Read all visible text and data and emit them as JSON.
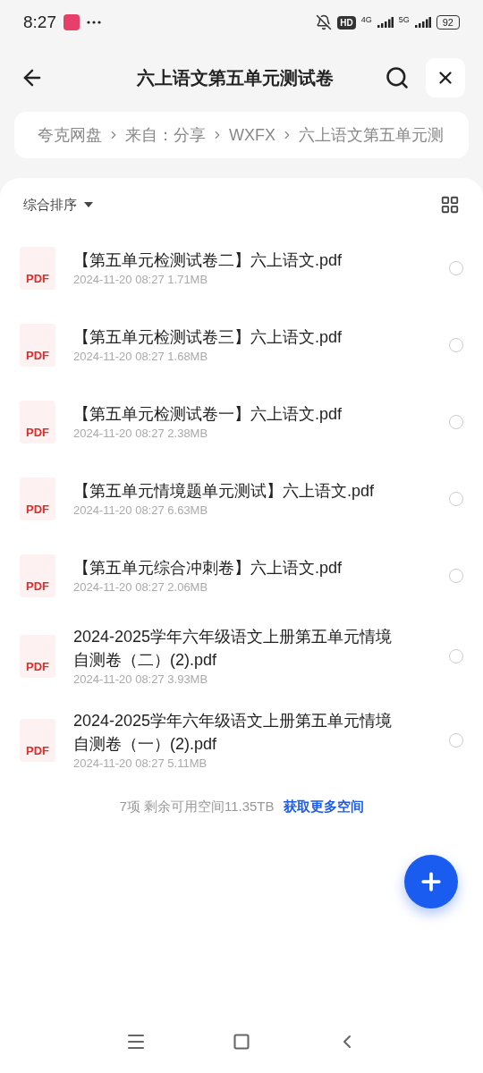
{
  "status_bar": {
    "time": "8:27",
    "hd": "HD",
    "net1": "4G",
    "net2": "5G",
    "battery": "92"
  },
  "header": {
    "title": "六上语文第五单元测试卷"
  },
  "breadcrumb": [
    "夸克网盘",
    "来自：分享",
    "WXFX",
    "六上语文第五单元测"
  ],
  "sort": {
    "label": "综合排序"
  },
  "files": [
    {
      "badge": "PDF",
      "name": "【第五单元检测试卷二】六上语文.pdf",
      "date": "2024-11-20 08:27",
      "size": "1.71MB",
      "selected": false
    },
    {
      "badge": "PDF",
      "name": "【第五单元检测试卷三】六上语文.pdf",
      "date": "2024-11-20 08:27",
      "size": "1.68MB",
      "selected": false
    },
    {
      "badge": "PDF",
      "name": "【第五单元检测试卷一】六上语文.pdf",
      "date": "2024-11-20 08:27",
      "size": "2.38MB",
      "selected": false
    },
    {
      "badge": "PDF",
      "name": "【第五单元情境题单元测试】六上语文.pdf",
      "date": "2024-11-20 08:27",
      "size": "6.63MB",
      "selected": false
    },
    {
      "badge": "PDF",
      "name": "【第五单元综合冲刺卷】六上语文.pdf",
      "date": "2024-11-20 08:27",
      "size": "2.06MB",
      "selected": false
    },
    {
      "badge": "PDF",
      "name": "2024-2025学年六年级语文上册第五单元情境自测卷（二）(2).pdf",
      "date": "2024-11-20 08:27",
      "size": "3.93MB",
      "selected": false
    },
    {
      "badge": "PDF",
      "name": "2024-2025学年六年级语文上册第五单元情境自测卷（一）(2).pdf",
      "date": "2024-11-20 08:27",
      "size": "5.11MB",
      "selected": false
    }
  ],
  "footer": {
    "summary": "7项 剩余可用空间11.35TB",
    "link": "获取更多空间"
  }
}
